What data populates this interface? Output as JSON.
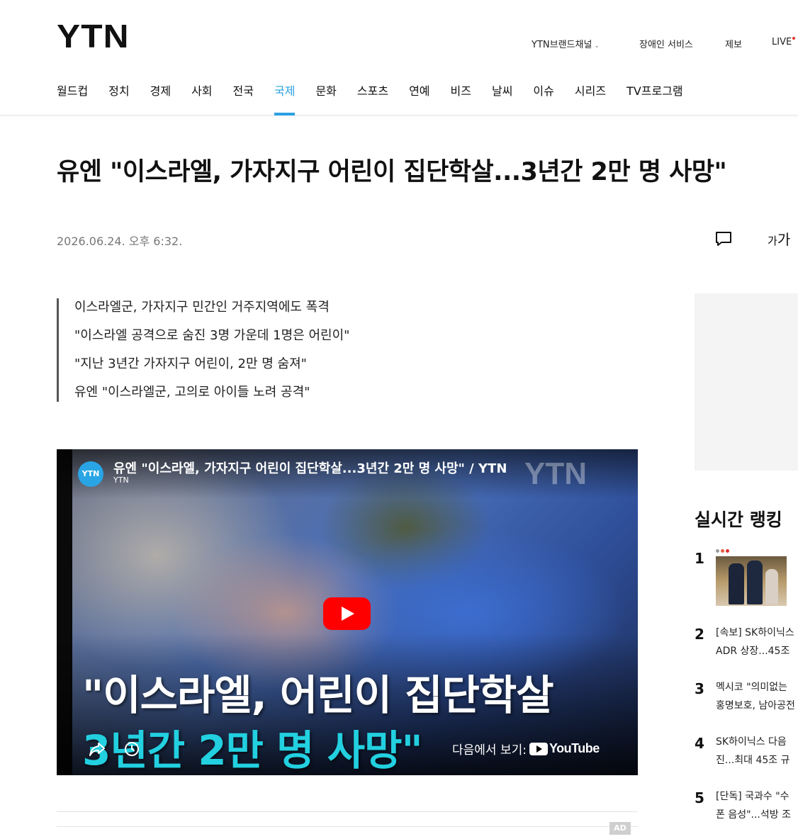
{
  "header": {
    "logo": "YTN",
    "utility": {
      "brand_channel": "YTN브랜드채널",
      "accessibility": "장애인 서비스",
      "report": "제보",
      "live": "LIVE"
    },
    "nav": [
      "월드컵",
      "정치",
      "경제",
      "사회",
      "전국",
      "국제",
      "문화",
      "스포츠",
      "연예",
      "비즈",
      "날씨",
      "이슈",
      "시리즈",
      "TV프로그램"
    ],
    "active_nav": "국제"
  },
  "article": {
    "headline": "유엔 \"이스라엘, 가자지구 어린이 집단학살...3년간 2만 명 사망\"",
    "date": "2026.06.24. 오후 6:32.",
    "font_size_button": {
      "small": "가",
      "large": "가"
    },
    "summary": [
      "이스라엘군, 가자지구 민간인 거주지역에도 폭격",
      "\"이스라엘 공격으로 숨진 3명 가운데 1명은 어린이\"",
      "\"지난 3년간 가자지구 어린이, 2만 명 숨져\"",
      "유엔 \"이스라엘군, 고의로 아이들 노려 공격\""
    ]
  },
  "video": {
    "channel_avatar": "YTN",
    "title": "유엔 \"이스라엘, 가자지구 어린이 집단학살...3년간 2만 명 사망\" / YTN",
    "channel": "YTN",
    "watermark": "YTN",
    "caption_line1": "\"이스라엘, 어린이 집단학살",
    "caption_line2": "3년간 2만 명 사망\"",
    "watch_on": "다음에서 보기:",
    "youtube": "YouTube"
  },
  "ad_badge": "AD",
  "sidebar": {
    "ranking_title": "실시간 랭킹",
    "ranking": [
      {
        "rank": "1",
        "text": ""
      },
      {
        "rank": "2",
        "text_line1": "[속보] SK하이닉스",
        "text_line2": "ADR 상장...45조"
      },
      {
        "rank": "3",
        "text_line1": "멕시코 \"의미없는",
        "text_line2": "홍명보호, 남아공전"
      },
      {
        "rank": "4",
        "text_line1": "SK하이닉스 다음",
        "text_line2": "진...최대 45조 규"
      },
      {
        "rank": "5",
        "text_line1": "[단독] 국과수 \"수",
        "text_line2": "폰 음성\"...석방 조"
      }
    ]
  },
  "colors": {
    "accent": "#2aa1e2",
    "caption_cyan": "#22d0e0",
    "youtube_red": "#ff0000"
  }
}
